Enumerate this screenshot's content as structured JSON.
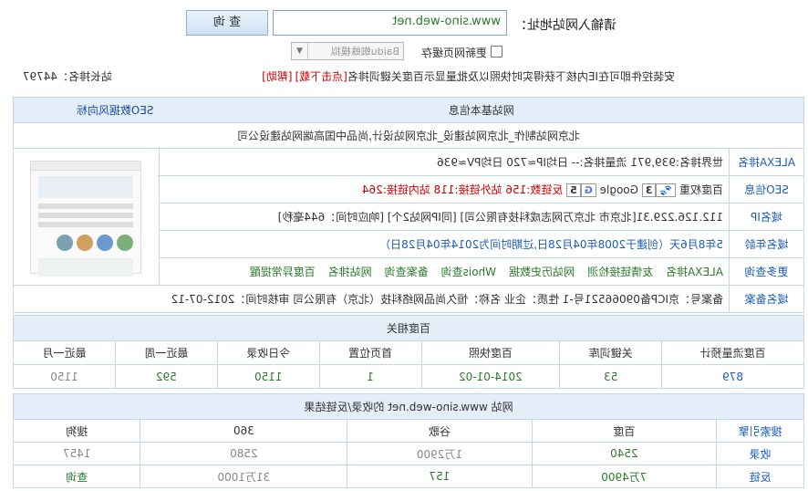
{
  "search": {
    "label": "请输入网站地址：",
    "url_value": "www.sino-web.net",
    "query_button": "查 询",
    "refresh_label": "更新网页缓存",
    "spider_select": "Baidu蜘蛛模拟"
  },
  "notice": {
    "text": "安装控件即可在IE内核下获得实时快照以及批量显示百度关键词排名",
    "download": "[点击下载]",
    "help": "[帮助]",
    "site_rank": "站长排名：44797"
  },
  "basic": {
    "header": "网站基本信息",
    "seo_link": "SEO数据风向标",
    "desc": "北京网站制作_北京网站建设_北京网站设计,尚品中国高端网站建设公司",
    "alexa_label": "ALEXA排名",
    "alexa_text": "世界排名:939,971  流量排名:--  日均IP≈720  日均PV≈936",
    "seo_label": "SEO信息",
    "seo_baidu_weight": "百度权重",
    "seo_baidu_value": "3",
    "seo_google": "Google",
    "seo_google_value": "5",
    "seo_links": "反链数:156  站外链接:118  站内链接:264",
    "ip_label": "域名IP",
    "ip_text": "112.126.229.31[北京市 北京万网志成科技有限公司] [同IP网站2个] [响应时间：644毫秒]",
    "age_label": "域名年龄",
    "age_text": "5年8月6天（创建于2008年04月28日,过期时间为2014年04月28日）",
    "more_label": "更多查询",
    "more_links": [
      "ALEXA排名",
      "友情链接检测",
      "网站历史数据",
      "Whois查询",
      "备案查询",
      "网站排名",
      "百度异常提醒"
    ],
    "icp_label": "域名备案",
    "icp_text": "备案号：京ICP备09066521号-1  性质：企业  名称：恒久尚品网络科技（北京）有限公司  审核时间：2012-07-12"
  },
  "baidu": {
    "header": "百度相关",
    "columns": [
      "百度流量预计",
      "关键词库",
      "百度快照",
      "首页位置",
      "今日收录",
      "最近一周",
      "最近一月"
    ],
    "values": [
      "879",
      "53",
      "2014-01-02",
      "1",
      "1150",
      "592",
      "1150"
    ]
  },
  "index": {
    "header": "网站 www.sino-web.net 的收录/反链结果",
    "columns": [
      "搜索引擎",
      "百度",
      "谷歌",
      "360",
      "搜狗"
    ],
    "rows": [
      {
        "name": "收录",
        "values": [
          "2540",
          "1万2900",
          "2580",
          "1457"
        ]
      },
      {
        "name": "反链",
        "values": [
          "7万4900",
          "157",
          "31万1000",
          "查询"
        ]
      }
    ]
  }
}
